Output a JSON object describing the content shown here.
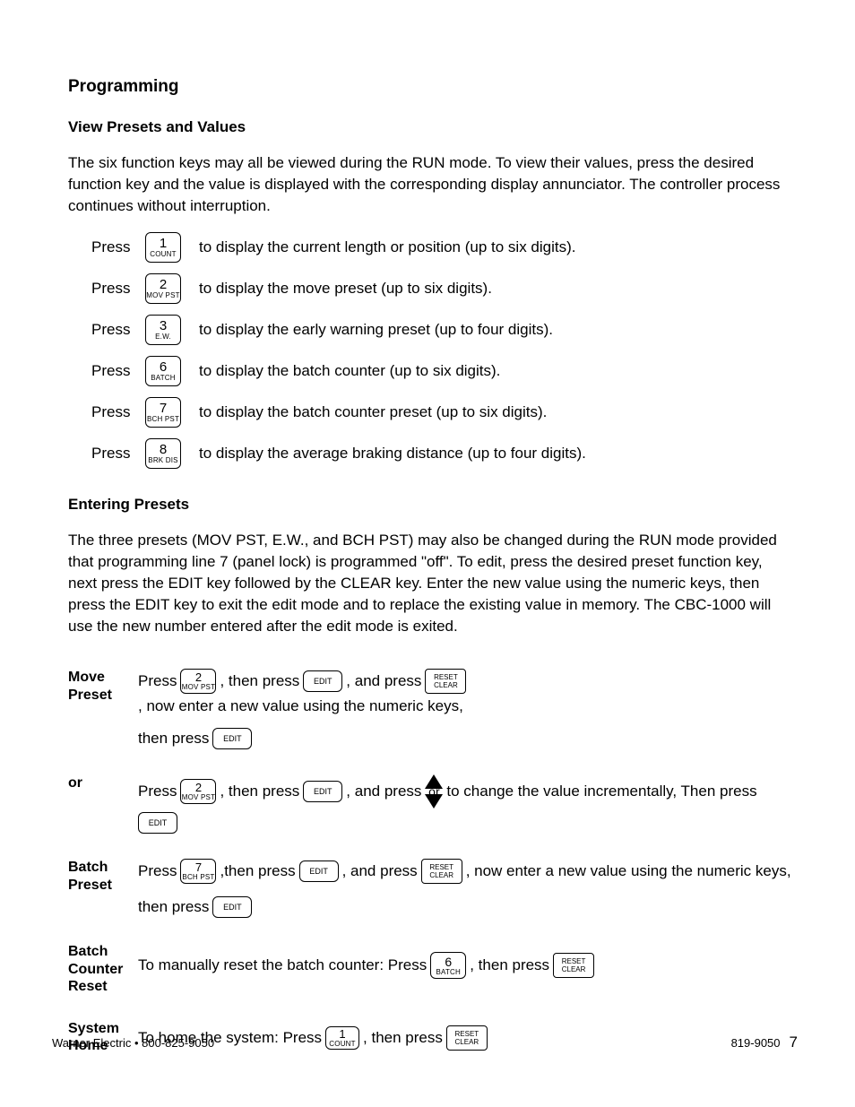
{
  "heading": "Programming",
  "section1": {
    "title": "View Presets and Values",
    "para": "The six function keys may all be viewed during the RUN mode. To view their values, press the desired function key and the value is displayed with the corresponding display annunciator. The controller process continues without interruption.",
    "press_label": "Press",
    "keys": [
      {
        "num": "1",
        "sub": "COUNT",
        "desc": "to display the current length or position (up to six digits)."
      },
      {
        "num": "2",
        "sub": "MOV PST",
        "desc": "to display the move preset (up to six digits)."
      },
      {
        "num": "3",
        "sub": "E.W.",
        "desc": "to display the early warning preset (up to four digits)."
      },
      {
        "num": "6",
        "sub": "BATCH",
        "desc": "to display the batch counter (up to six digits)."
      },
      {
        "num": "7",
        "sub": "BCH PST",
        "desc": "to display the batch counter preset (up to six digits)."
      },
      {
        "num": "8",
        "sub": "BRK DIS",
        "desc": "to display the average braking distance (up to four digits)."
      }
    ]
  },
  "section2": {
    "title": "Entering Presets",
    "para": "The three presets (MOV PST, E.W., and BCH PST) may also be changed during the RUN mode provided that programming line 7 (panel lock) is programmed \"off\". To edit, press the desired preset function key, next press the EDIT key followed by the CLEAR key.  Enter the new value using the numeric keys, then press the EDIT key to exit the edit mode and to replace the existing value in memory. The CBC-1000 will use the new number entered after the edit mode is exited."
  },
  "labels": {
    "move_preset": "Move Preset",
    "or": "or",
    "batch_preset": "Batch Preset",
    "batch_counter_reset": "Batch Counter Reset",
    "system_home": "System Home"
  },
  "text": {
    "press": "Press",
    "then_press": ", then press",
    "then_press_nocomma": "then press",
    "and_press": ", and press",
    "now_enter": ", now enter a new value using the numeric keys,",
    "change_inc": "to change the value incrementally, Then press",
    "to_manual_reset": "To manually reset the batch counter: Press",
    "to_home": "To home the system: Press",
    "thenpress2": ", then press",
    "thenpress3": ",then press",
    "or_mid": "or"
  },
  "keylabels": {
    "edit": "EDIT",
    "reset": "RESET",
    "clear": "CLEAR",
    "k2n": "2",
    "k2s": "MOV PST",
    "k7n": "7",
    "k7s": "BCH PST",
    "k6n": "6",
    "k6s": "BATCH",
    "k1n": "1",
    "k1s": "COUNT"
  },
  "footer": {
    "left": "Warner Electric • 800-825-9050",
    "doc": "819-9050",
    "page": "7"
  }
}
